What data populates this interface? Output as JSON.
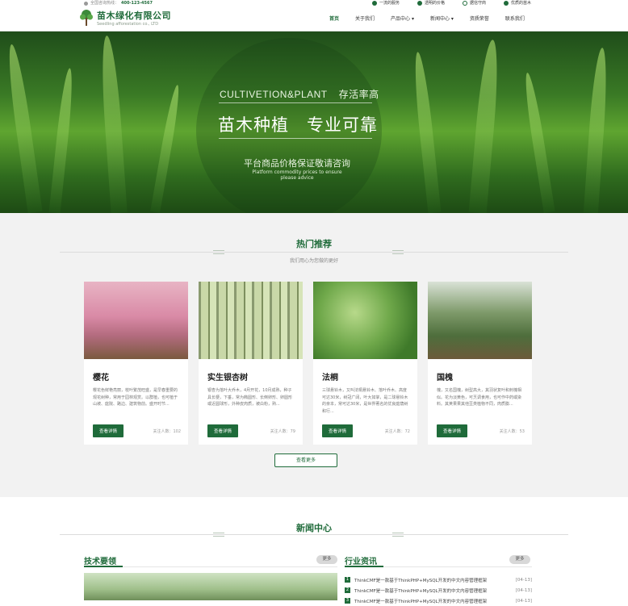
{
  "topbar": {
    "hotline_label": "全国咨询热线：",
    "hotline_number": "400-123-4567",
    "features": [
      "一流的服务",
      "透明的价格",
      "据信守商",
      "优质的苗木"
    ]
  },
  "header": {
    "logo_cn": "苗木绿化有限公司",
    "logo_en": "Seedling afforestation co., LTD",
    "nav": [
      "首页",
      "关于我们",
      "产品中心 ▾",
      "新闻中心 ▾",
      "资质荣誉",
      "联系我们"
    ]
  },
  "hero": {
    "line1_en": "CULTIVETION&PLANT",
    "line1_cn": "存活率高",
    "headline": "苗木种植　专业可靠",
    "sub_cn": "平台商品价格保证敬请咨询",
    "sub_en": "Platform commodity prices to ensure please advice"
  },
  "hot": {
    "title": "热门推荐",
    "subtitle": "我们用心为您做的更好",
    "more": "查看更多",
    "detail_label": "查看详情",
    "items": [
      {
        "name": "樱花",
        "desc": "樱花色鲜艳亮丽，枝叶繁茂旺盛，是早春重要的观花树种，常用于园林观赏。以群植，也可植于山坡、庭院、路边、建筑物前。盛开时节...",
        "count": "关注人数：102",
        "img": "cherry"
      },
      {
        "name": "实生银杏树",
        "desc": "银杏为落叶大乔木，4月开花，10月成熟，种子具长梗，下垂，常为椭圆形、长倒卵形、卵圆形或近圆球形，外种皮肉质，被白粉，熟...",
        "count": "关注人数：79",
        "img": "ginkgo"
      },
      {
        "name": "法桐",
        "desc": "三球悬铃木，又叫法桐悬铃木、落叶乔木、高度可达30米，树冠广阔，叶大如掌，是二球悬铃木的亲本，常可达30米，是世界著名的优良庭荫树和行...",
        "count": "关注人数：72",
        "img": "plane"
      },
      {
        "name": "国槐",
        "desc": "槐，又名国槐，树型高大，其羽状复叶和刺槐相似。花为淡黄色，可烹调食用，也可作中药或染料。其荚果果其他豆类植物不同，肉质膨...",
        "count": "关注人数：53",
        "img": "locust"
      }
    ]
  },
  "news": {
    "title": "新闻中心",
    "tech_title": "技术要领",
    "industry_title": "行业资讯",
    "more": "更多",
    "items": [
      {
        "num": "1",
        "text": "ThinkCMF是一款基于ThinkPHP+MySQL开发的中文内容管理框架",
        "date": "[04-13]"
      },
      {
        "num": "2",
        "text": "ThinkCMF是一款基于ThinkPHP+MySQL开发的中文内容管理框架",
        "date": "[04-13]"
      },
      {
        "num": "3",
        "text": "ThinkCMF是一款基于ThinkPHP+MySQL开发的中文内容管理框架",
        "date": "[04-13]"
      }
    ]
  },
  "colors": {
    "brand": "#1f6b3a",
    "bg_gray": "#f2f2f2"
  }
}
